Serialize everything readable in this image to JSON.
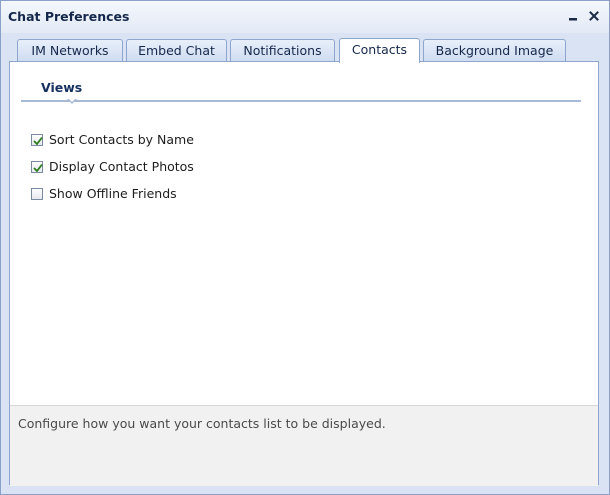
{
  "window": {
    "title": "Chat Preferences",
    "minimize_glyph": "▬",
    "close_glyph": "×"
  },
  "tabs": [
    {
      "label": "IM Networks",
      "active": false
    },
    {
      "label": "Embed Chat",
      "active": false
    },
    {
      "label": "Notifications",
      "active": false
    },
    {
      "label": "Contacts",
      "active": true
    },
    {
      "label": "Background Image",
      "active": false
    }
  ],
  "section": {
    "title": "Views"
  },
  "options": [
    {
      "label": "Sort Contacts by Name",
      "checked": true
    },
    {
      "label": "Display Contact Photos",
      "checked": true
    },
    {
      "label": "Show Offline Friends",
      "checked": false
    }
  ],
  "footer": {
    "description": "Configure how you want your contacts list to be displayed."
  },
  "colors": {
    "accent": "#15305f",
    "check": "#2e7d1f"
  }
}
